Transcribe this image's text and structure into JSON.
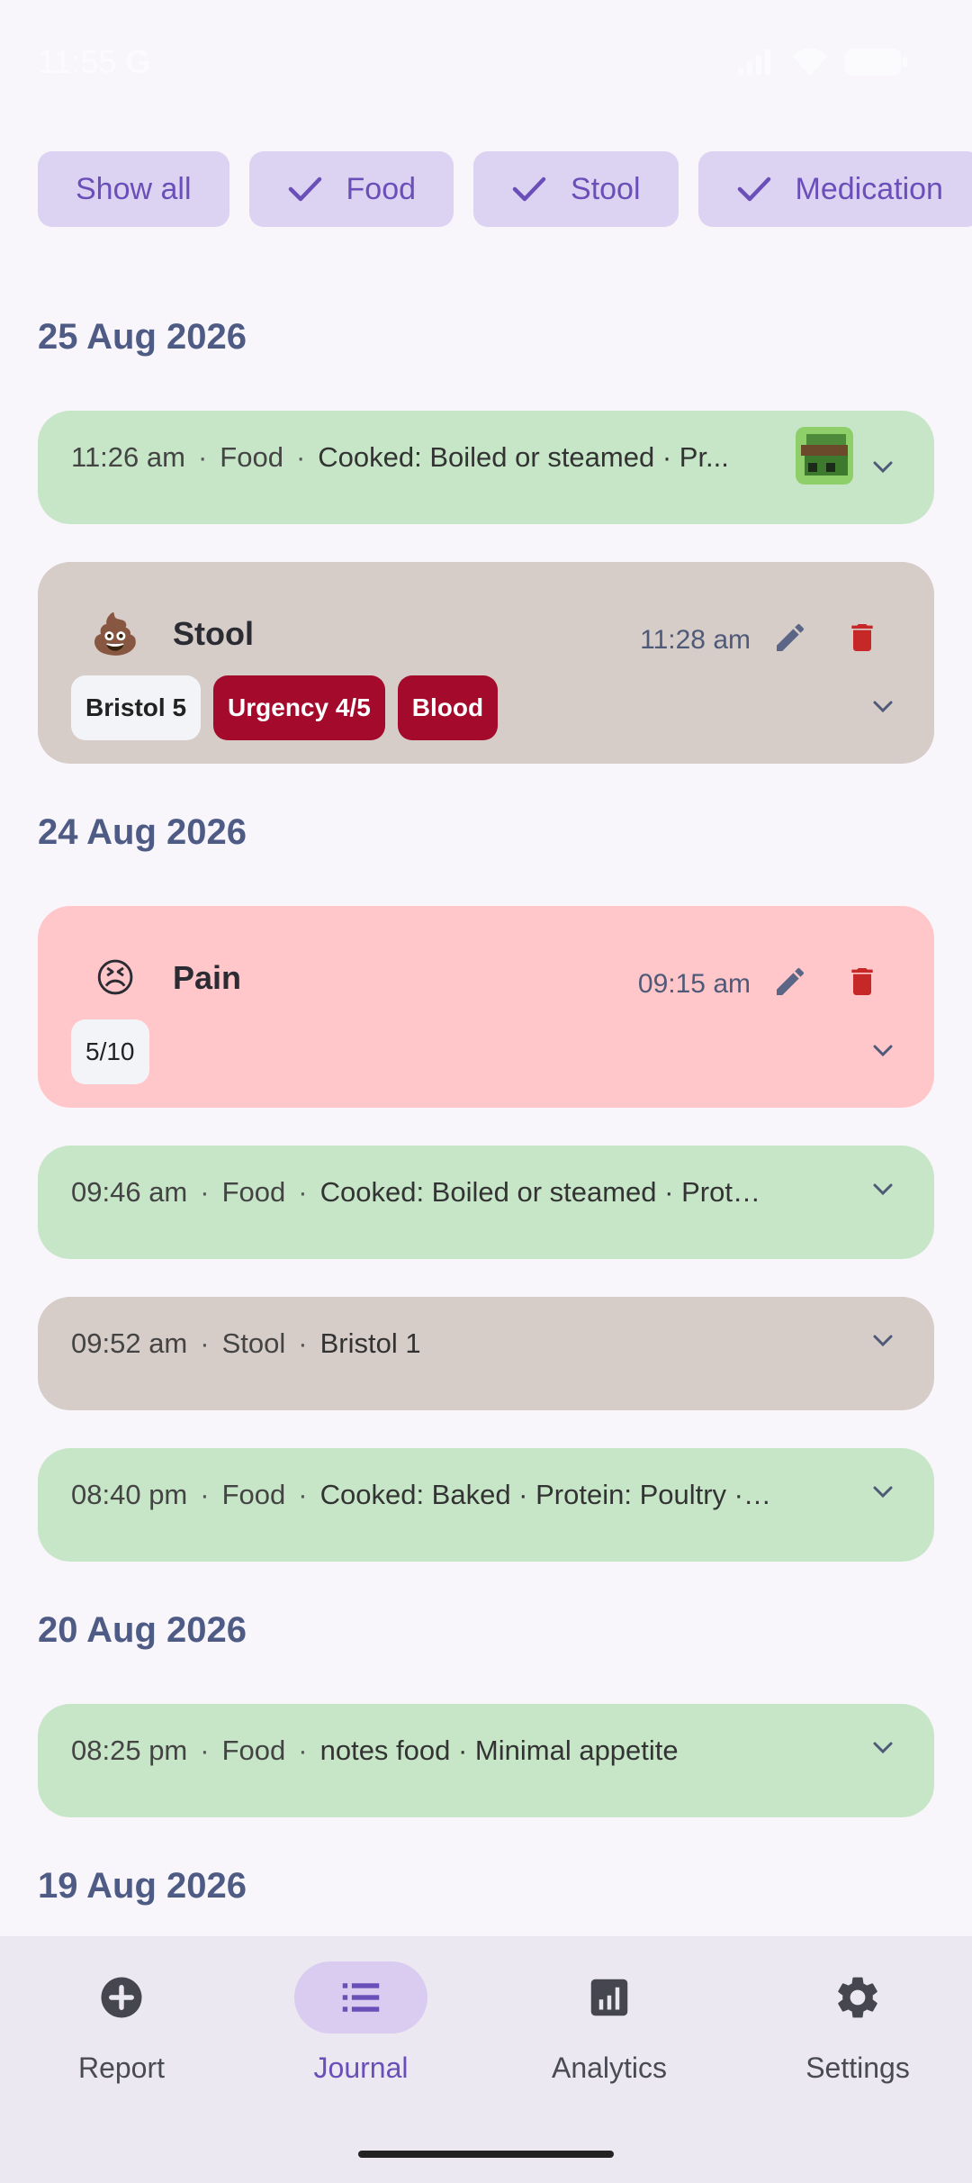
{
  "status": {
    "time": "11:55",
    "g": "G"
  },
  "filters": [
    {
      "label": "Show all",
      "checked": false
    },
    {
      "label": "Food",
      "checked": true
    },
    {
      "label": "Stool",
      "checked": true
    },
    {
      "label": "Medication",
      "checked": true
    }
  ],
  "dates": [
    "25 Aug 2026",
    "24 Aug 2026",
    "20 Aug 2026",
    "19 Aug 2026"
  ],
  "entries": {
    "food1": {
      "time": "11:26 am",
      "category": "Food",
      "details": "Cooked: Boiled or steamed · Pr..."
    },
    "stool1": {
      "emoji": "💩",
      "title": "Stool",
      "time": "11:28 am",
      "badges": [
        "Bristol 5",
        "Urgency 4/5",
        "Blood"
      ]
    },
    "pain1": {
      "emoji": "😣",
      "title": "Pain",
      "time": "09:15 am",
      "badges": [
        "5/10"
      ]
    },
    "food2": {
      "time": "09:46 am",
      "category": "Food",
      "details": "Cooked: Boiled or steamed · Protein: ..."
    },
    "stool2": {
      "time": "09:52 am",
      "category": "Stool",
      "details": "Bristol 1"
    },
    "food3": {
      "time": "08:40 pm",
      "category": "Food",
      "details": "Cooked: Baked · Protein: Poultry · Co..."
    },
    "food4": {
      "time": "08:25 pm",
      "category": "Food",
      "details": "notes food · Minimal appetite"
    }
  },
  "separator": "·",
  "nav": [
    {
      "label": "Report",
      "icon": "add-circle-icon",
      "active": false
    },
    {
      "label": "Journal",
      "icon": "list-icon",
      "active": true
    },
    {
      "label": "Analytics",
      "icon": "analytics-icon",
      "active": false
    },
    {
      "label": "Settings",
      "icon": "gear-icon",
      "active": false
    }
  ],
  "colors": {
    "accent": "#6b4fb8",
    "food": "#c6e6c7",
    "stool": "#d6ccc8",
    "pain": "#ffc7ca",
    "alert": "#a30a2c"
  }
}
